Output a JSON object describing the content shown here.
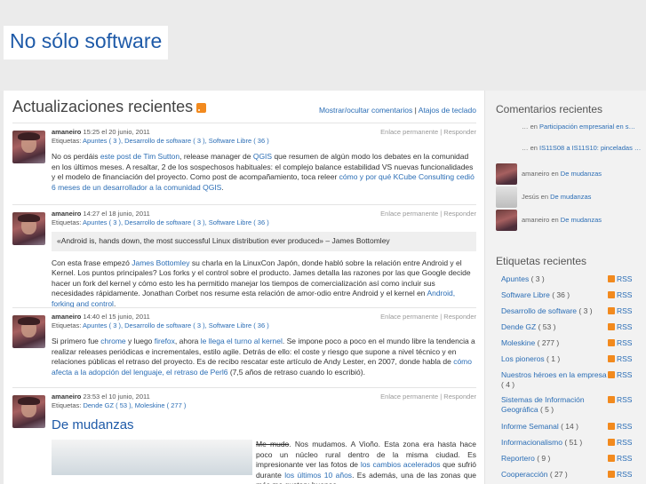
{
  "site": {
    "title": "No sólo software"
  },
  "main": {
    "title": "Actualizaciones recientes",
    "toggle_comments": "Mostrar/ocultar comentarios",
    "separator": "|",
    "shortcuts": "Atajos de teclado",
    "posts": [
      {
        "author": "amaneiro",
        "date": "15:25 el 20 junio, 2011",
        "tags_label": "Etiquetas:",
        "tags": "Apuntes ( 3 ), Desarrollo de software ( 3 ), Software Libre ( 36 )",
        "permalink": "Enlace permanente | Responder",
        "p1a": "No os perdáis ",
        "p1link": "este post de Tim Sutton",
        "p1b": ", release manager de ",
        "p1link2": "QGIS",
        "p1c": " que resumen de algún modo los debates en la comunidad en los últimos meses. A resaltar, 2 de los sospechosos habituales: el complejo balance estabilidad VS nuevas funcionalidades y el modelo de financiación del proyecto. Como post de acompañamiento, toca releer ",
        "p1link3": "cómo y por qué KCube Consulting cedió 6 meses de un desarrollador a la comunidad QGIS",
        "p1d": "."
      },
      {
        "author": "amaneiro",
        "date": "14:27 el 18 junio, 2011",
        "tags_label": "Etiquetas:",
        "tags": "Apuntes ( 3 ), Desarrollo de software ( 3 ), Software Libre ( 36 )",
        "permalink": "Enlace permanente | Responder",
        "quote": "«Android is, hands down, the most successful Linux distribution ever produced» – James Bottomley",
        "p1a": "Con esta frase empezó ",
        "p1link": "James Bottomley",
        "p1b": " su charla en la LinuxCon Japón, donde habló sobre la relación entre Android y el Kernel. Los puntos principales? Los forks y el control sobre el producto. James detalla las razones por las que Google decide hacer un fork del kernel y cómo esto les ha permitido manejar los tiempos de comercialización así como incluir sus necesidades rápidamente. Jonathan Corbet nos resume esta relación de amor-odio entre Android y el kernel en ",
        "p1link2": "Android, forking and control",
        "p1c": "."
      },
      {
        "author": "amaneiro",
        "date": "14:40 el 15 junio, 2011",
        "tags_label": "Etiquetas:",
        "tags": "Apuntes ( 3 ), Desarrollo de software ( 3 ), Software Libre ( 36 )",
        "permalink": "Enlace permanente | Responder",
        "p1a": "Si primero fue ",
        "p1link": "chrome",
        "p1b": " y luego ",
        "p1link2": "firefox",
        "p1c": ", ahora ",
        "p1link3": "le llega el turno al kernel",
        "p1d": ". Se impone poco a poco en el mundo libre la tendencia a realizar releases periódicas e incrementales, estilo agile. Detrás de ello: el coste y riesgo que supone a nivel técnico y en relaciones públicas el retraso del proyecto. Es de recibo rescatar este artículo de Andy Lester, en 2007, donde habla de ",
        "p1link4": "cómo afecta a la adopción del lenguaje, el retraso de Perl6",
        "p1e": " (7,5 años de retraso cuando lo escribió)."
      },
      {
        "author": "amaneiro",
        "date": "23:53 el 10 junio, 2011",
        "tags_label": "Etiquetas:",
        "tags": "Dende GZ ( 53 ), Moleskine ( 277 )",
        "permalink": "Enlace permanente | Responder",
        "title": "De mudanzas",
        "strike": "Me mudo",
        "p1a": ". Nos mudamos. A Vioño. Esta zona era hasta hace poco un núcleo rural dentro de la misma ciudad. Es impresionante ver las fotos de ",
        "p1link": "los cambios acelerados",
        "p1b": " que sufrió durante ",
        "p1link2": "los últimos 10 años",
        "p1c": ". Es además, una de las zonas que más me gustan: buenas"
      }
    ]
  },
  "sidebar": {
    "comments_title": "Comentarios recientes",
    "comments": [
      {
        "prefix": "… en ",
        "link": "Participación empresarial en s…",
        "avatar": "none"
      },
      {
        "prefix": "… en ",
        "link": "IS11S08 a IS11S10: pinceladas …",
        "avatar": "none"
      },
      {
        "prefix": "amaneiro en ",
        "link": "De mudanzas",
        "avatar": "photo"
      },
      {
        "prefix": "Jesús en ",
        "link": "De mudanzas",
        "avatar": "grey"
      },
      {
        "prefix": "amaneiro en ",
        "link": "De mudanzas",
        "avatar": "photo"
      }
    ],
    "tags_title": "Etiquetas recientes",
    "rss_label": "RSS",
    "tags": [
      {
        "name": "Apuntes",
        "count": "( 3 )"
      },
      {
        "name": "Software Libre",
        "count": "( 36 )"
      },
      {
        "name": "Desarrollo de software",
        "count": "( 3 )"
      },
      {
        "name": "Dende GZ",
        "count": "( 53 )"
      },
      {
        "name": "Moleskine",
        "count": "( 277 )"
      },
      {
        "name": "Los pioneros",
        "count": "( 1 )"
      },
      {
        "name": "Nuestros héroes en la empresa",
        "count": "( 4 )"
      },
      {
        "name": "Sistemas de Información Geográfica",
        "count": "( 5 )"
      },
      {
        "name": "Informe Semanal",
        "count": "( 14 )"
      },
      {
        "name": "Informacionalismo",
        "count": "( 51 )"
      },
      {
        "name": "Reportero",
        "count": "( 9 )"
      },
      {
        "name": "Cooperacción",
        "count": "( 27 )"
      }
    ]
  }
}
